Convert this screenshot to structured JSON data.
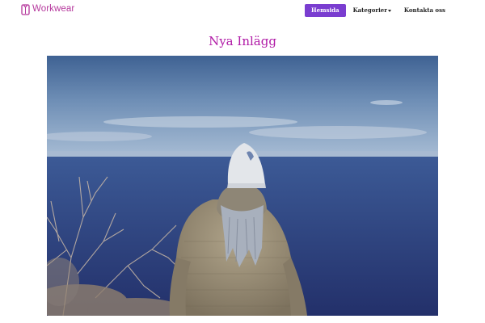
{
  "header": {
    "brand_name": "Workwear",
    "brand_icon": "workwear-logo-icon",
    "brand_color": "#b5379c"
  },
  "nav": {
    "items": [
      {
        "label": "Hemsida",
        "active": true
      },
      {
        "label": "Kategorier",
        "has_dropdown": true
      },
      {
        "label": "Kontakta oss"
      }
    ],
    "active_color": "#7a3dd0"
  },
  "main": {
    "title": "Nya Inlägg",
    "title_color": "#b01aa6"
  }
}
